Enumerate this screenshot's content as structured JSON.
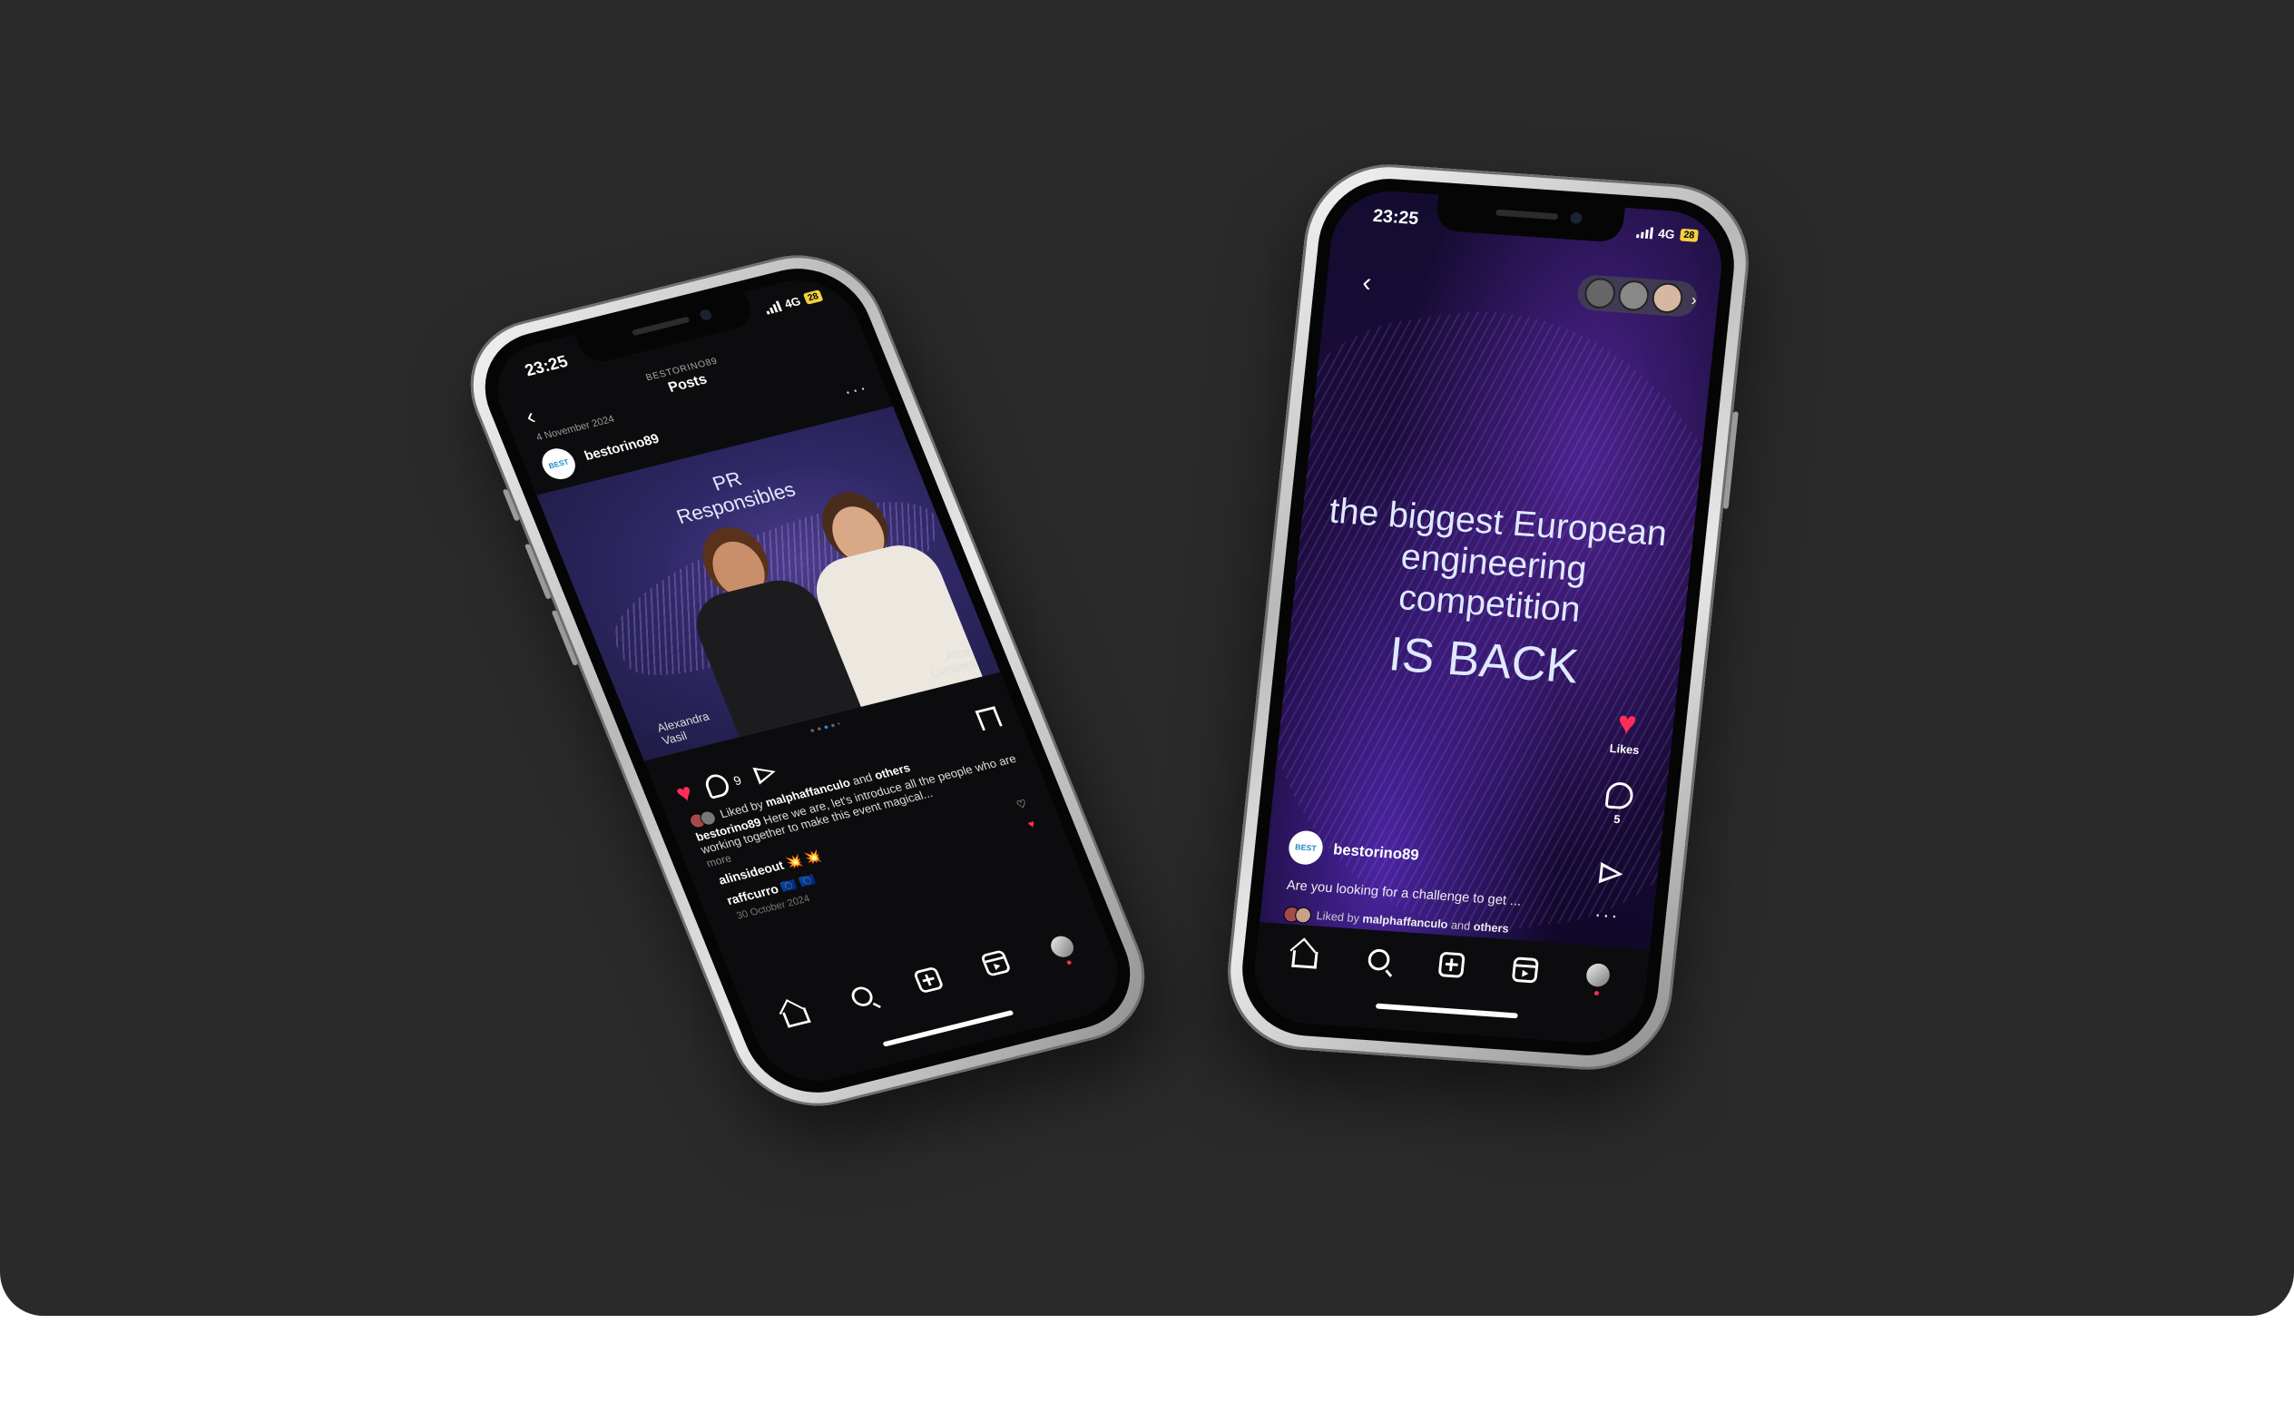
{
  "left_phone": {
    "status": {
      "time": "23:25",
      "network": "4G",
      "battery": "28"
    },
    "header": {
      "account_label": "BESTORINO89",
      "title": "Posts",
      "date": "4 November 2024"
    },
    "post": {
      "username": "bestorino89",
      "image_title_line1": "PR",
      "image_title_line2": "Responsibles",
      "person_left_first": "Alexandra",
      "person_left_last": "Vasil",
      "person_right_first": "Alice",
      "person_right_last": "Lamberti",
      "comment_count": "9",
      "liked_by_prefix": "Liked by",
      "liked_by_user": "malphaffanculo",
      "liked_by_and": "and",
      "liked_by_others": "others",
      "caption_user": "bestorino89",
      "caption_text": "Here we are, let's introduce all the people who are working together to make this event magical...",
      "more": "more",
      "comments": [
        {
          "user": "alinsideout",
          "text": "💥 💥"
        },
        {
          "user": "raffcurro",
          "text": "🇪🇺 🇪🇺"
        }
      ],
      "comment_date": "30 October 2024"
    }
  },
  "right_phone": {
    "status": {
      "time": "23:25",
      "network": "4G",
      "battery": "28"
    },
    "reel": {
      "line1": "the biggest European",
      "line2": "engineering",
      "line3": "competition",
      "line4": "IS BACK",
      "likes_label": "Likes",
      "comment_count": "5",
      "username": "bestorino89",
      "caption": "Are you looking for a challenge to get ...",
      "liked_by_prefix": "Liked by",
      "liked_by_user": "malphaffanculo",
      "liked_by_and": "and",
      "liked_by_others": "others"
    }
  },
  "colors": {
    "background": "#2a2a2a",
    "accent_heart": "#ff2d55",
    "reel_purple": "#2a145e"
  }
}
